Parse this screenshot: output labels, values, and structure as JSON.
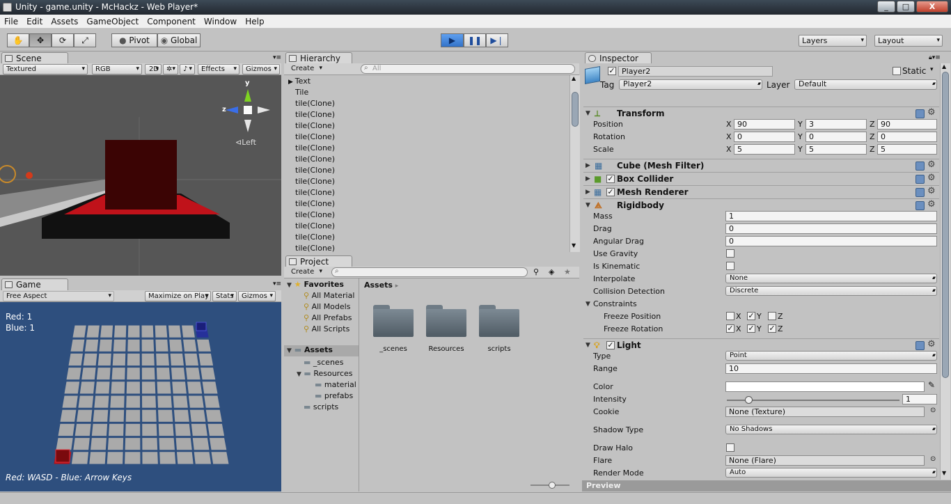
{
  "window": {
    "title": "Unity - game.unity - McHackz - Web Player*",
    "min": "_",
    "max": "□",
    "close": "X"
  },
  "menu": [
    "File",
    "Edit",
    "Assets",
    "GameObject",
    "Component",
    "Window",
    "Help"
  ],
  "toolbar": {
    "pivot": "Pivot",
    "global": "Global",
    "layers": "Layers",
    "layout": "Layout"
  },
  "scene": {
    "tab": "Scene",
    "shading": "Textured",
    "render": "RGB",
    "mode2d": "2D",
    "effects": "Effects",
    "gizmos": "Gizmos",
    "axis_y": "y",
    "axis_z": "z",
    "view_label": "Left"
  },
  "game": {
    "tab": "Game",
    "aspect": "Free Aspect",
    "maximize": "Maximize on Play",
    "stats": "Stats",
    "gizmos": "Gizmos",
    "score_red": "Red: 1",
    "score_blue": "Blue: 1",
    "controls": "Red: WASD - Blue: Arrow Keys",
    "colors": {
      "bg": "#2e4f7e",
      "tile": "#aaaaaa",
      "red": "#b3121a",
      "blue": "#26309a"
    }
  },
  "hierarchy": {
    "tab": "Hierarchy",
    "create": "Create",
    "search_placeholder": "All",
    "items": [
      "Text",
      "Tile",
      "tile(Clone)",
      "tile(Clone)",
      "tile(Clone)",
      "tile(Clone)",
      "tile(Clone)",
      "tile(Clone)",
      "tile(Clone)",
      "tile(Clone)",
      "tile(Clone)",
      "tile(Clone)",
      "tile(Clone)",
      "tile(Clone)",
      "tile(Clone)",
      "tile(Clone)"
    ]
  },
  "project": {
    "tab": "Project",
    "create": "Create",
    "favorites": {
      "label": "Favorites",
      "items": [
        "All Material",
        "All Models",
        "All Prefabs",
        "All Scripts"
      ]
    },
    "assets_tree": {
      "label": "Assets",
      "children": [
        "_scenes",
        "Resources",
        "material",
        "prefabs",
        "scripts"
      ]
    },
    "breadcrumb": "Assets",
    "folders": [
      "_scenes",
      "Resources",
      "scripts"
    ]
  },
  "inspector": {
    "tab": "Inspector",
    "object_name": "Player2",
    "static_label": "Static",
    "tag_label": "Tag",
    "tag_value": "Player2",
    "layer_label": "Layer",
    "layer_value": "Default",
    "transform": {
      "title": "Transform",
      "position": {
        "label": "Position",
        "x": "90",
        "y": "3",
        "z": "90"
      },
      "rotation": {
        "label": "Rotation",
        "x": "0",
        "y": "0",
        "z": "0"
      },
      "scale": {
        "label": "Scale",
        "x": "5",
        "y": "5",
        "z": "5"
      },
      "axis_x": "X",
      "axis_y": "Y",
      "axis_z": "Z"
    },
    "mesh_filter": "Cube (Mesh Filter)",
    "box_collider": "Box Collider",
    "mesh_renderer": "Mesh Renderer",
    "rigidbody": {
      "title": "Rigidbody",
      "mass_label": "Mass",
      "mass": "1",
      "drag_label": "Drag",
      "drag": "0",
      "angular_drag_label": "Angular Drag",
      "angular_drag": "0",
      "use_gravity_label": "Use Gravity",
      "is_kinematic_label": "Is Kinematic",
      "interpolate_label": "Interpolate",
      "interpolate": "None",
      "collision_label": "Collision Detection",
      "collision": "Discrete",
      "constraints_label": "Constraints",
      "freeze_pos_label": "Freeze Position",
      "freeze_rot_label": "Freeze Rotation",
      "x": "X",
      "y": "Y",
      "z": "Z"
    },
    "light": {
      "title": "Light",
      "type_label": "Type",
      "type": "Point",
      "range_label": "Range",
      "range": "10",
      "color_label": "Color",
      "intensity_label": "Intensity",
      "intensity": "1",
      "cookie_label": "Cookie",
      "cookie": "None (Texture)",
      "shadow_label": "Shadow Type",
      "shadow": "No Shadows",
      "halo_label": "Draw Halo",
      "flare_label": "Flare",
      "flare": "None (Flare)",
      "render_mode_label": "Render Mode",
      "render_mode": "Auto"
    },
    "preview": "Preview"
  }
}
